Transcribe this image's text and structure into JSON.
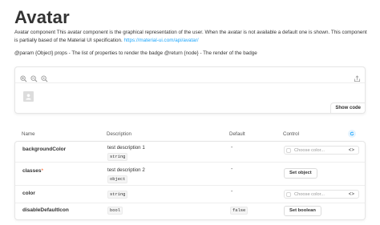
{
  "page": {
    "title": "Avatar",
    "description": "Avatar component This avatar component is the graphical representation of the user. When the avatar is not available a default one is shown. This component is partially based of the Material UI specification.",
    "link_text": "https://material-ui.com/api/avatar/",
    "params": "@param {Object} props - The list of properties to render the badge @return {node} - The render of the badge"
  },
  "preview": {
    "toolbar_icons": [
      "zoom-in-icon",
      "zoom-out-icon",
      "zoom-reset-icon",
      "share-icon"
    ],
    "show_code_label": "Show code"
  },
  "props_table": {
    "headers": {
      "name": "Name",
      "description": "Description",
      "default": "Default",
      "control": "Control"
    },
    "rows": [
      {
        "name": "backgroundColor",
        "required": false,
        "description": "test description 1",
        "type": "string",
        "default": "-",
        "control": {
          "kind": "color",
          "placeholder": "Choose color...",
          "toggle": "<>"
        }
      },
      {
        "name": "classes",
        "required": true,
        "required_mark": "*",
        "description": "test description 2",
        "type": "object",
        "default": "-",
        "control": {
          "kind": "button",
          "label": "Set object"
        }
      },
      {
        "name": "color",
        "required": false,
        "description": "",
        "type": "string",
        "default": "-",
        "control": {
          "kind": "color",
          "placeholder": "Choose color...",
          "toggle": "<>"
        }
      },
      {
        "name": "disableDefaultIcon",
        "required": false,
        "description": "",
        "type": "bool",
        "default": "false",
        "control": {
          "kind": "button",
          "label": "Set boolean"
        }
      }
    ]
  },
  "colors": {
    "link": "#1ea7fd",
    "accent": "#1ea7fd",
    "required": "#ff4400"
  }
}
